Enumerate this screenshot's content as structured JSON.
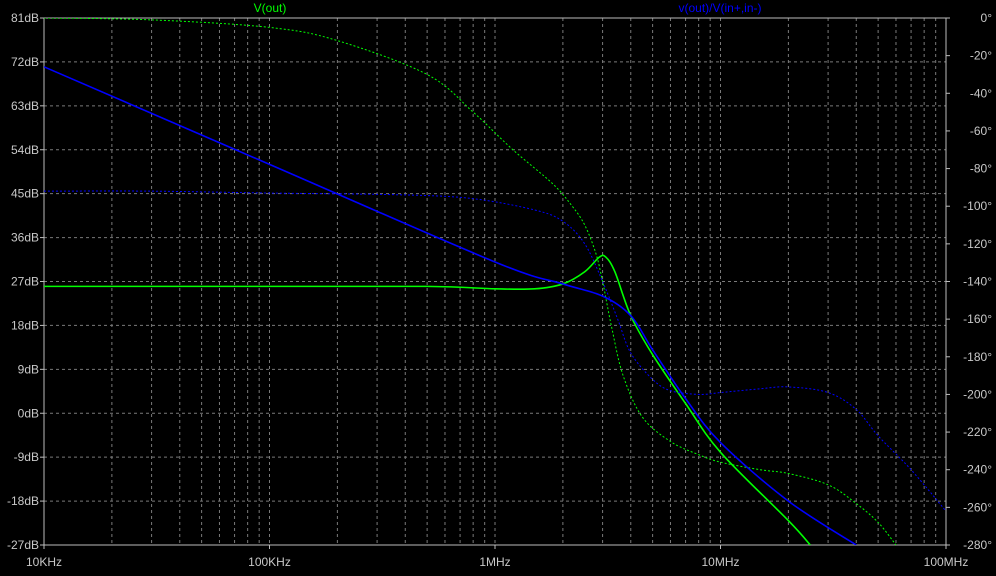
{
  "window": {
    "background": "#000000",
    "grid_color": "#7a7a7a",
    "axis_color": "#bdbdbd"
  },
  "chart_data": {
    "type": "line",
    "title": "",
    "xlabel": "",
    "ylabel": "",
    "xscale": "log",
    "xlim": [
      10000,
      100000000
    ],
    "ylim": [
      -27,
      81
    ],
    "y2lim": [
      -280,
      0
    ],
    "grid": true,
    "x_tick_labels": [
      {
        "value": 10000,
        "label": "10KHz"
      },
      {
        "value": 100000,
        "label": "100KHz"
      },
      {
        "value": 1000000,
        "label": "1MHz"
      },
      {
        "value": 10000000,
        "label": "10MHz"
      },
      {
        "value": 100000000,
        "label": "100MHz"
      }
    ],
    "y_tick_labels": [
      {
        "value": 81,
        "label": "81dB"
      },
      {
        "value": 72,
        "label": "72dB"
      },
      {
        "value": 63,
        "label": "63dB"
      },
      {
        "value": 54,
        "label": "54dB"
      },
      {
        "value": 45,
        "label": "45dB"
      },
      {
        "value": 36,
        "label": "36dB"
      },
      {
        "value": 27,
        "label": "27dB"
      },
      {
        "value": 18,
        "label": "18dB"
      },
      {
        "value": 9,
        "label": "9dB"
      },
      {
        "value": 0,
        "label": "0dB"
      },
      {
        "value": -9,
        "label": "-9dB"
      },
      {
        "value": -18,
        "label": "-18dB"
      },
      {
        "value": -27,
        "label": "-27dB"
      }
    ],
    "y2_tick_labels": [
      {
        "value": 0,
        "label": "0°"
      },
      {
        "value": -20,
        "label": "-20°"
      },
      {
        "value": -40,
        "label": "-40°"
      },
      {
        "value": -60,
        "label": "-60°"
      },
      {
        "value": -80,
        "label": "-80°"
      },
      {
        "value": -100,
        "label": "-100°"
      },
      {
        "value": -120,
        "label": "-120°"
      },
      {
        "value": -140,
        "label": "-140°"
      },
      {
        "value": -160,
        "label": "-160°"
      },
      {
        "value": -180,
        "label": "-180°"
      },
      {
        "value": -200,
        "label": "-200°"
      },
      {
        "value": -220,
        "label": "-220°"
      },
      {
        "value": -240,
        "label": "-240°"
      },
      {
        "value": -260,
        "label": "-260°"
      },
      {
        "value": -280,
        "label": "-280°"
      }
    ],
    "series": [
      {
        "name": "V(out)",
        "color": "#00ff00",
        "magnitude_db": [
          [
            10000,
            26
          ],
          [
            100000,
            26
          ],
          [
            500000,
            26
          ],
          [
            1000000,
            25.5
          ],
          [
            1500000,
            25.5
          ],
          [
            2000000,
            26.5
          ],
          [
            2500000,
            29
          ],
          [
            2900000,
            32
          ],
          [
            3100000,
            32
          ],
          [
            3400000,
            29
          ],
          [
            4000000,
            20
          ],
          [
            5000000,
            12
          ],
          [
            7000000,
            2
          ],
          [
            10000000,
            -8
          ],
          [
            20000000,
            -22
          ],
          [
            25000000,
            -27
          ]
        ],
        "phase_deg": [
          [
            10000,
            0
          ],
          [
            30000,
            -1
          ],
          [
            100000,
            -5
          ],
          [
            200000,
            -12
          ],
          [
            500000,
            -30
          ],
          [
            800000,
            -50
          ],
          [
            1200000,
            -70
          ],
          [
            1800000,
            -88
          ],
          [
            2200000,
            -100
          ],
          [
            2500000,
            -110
          ],
          [
            2800000,
            -125
          ],
          [
            3000000,
            -140
          ],
          [
            3300000,
            -165
          ],
          [
            3700000,
            -190
          ],
          [
            4500000,
            -212
          ],
          [
            6000000,
            -225
          ],
          [
            8000000,
            -232
          ],
          [
            10000000,
            -236
          ],
          [
            15000000,
            -240
          ],
          [
            20000000,
            -242
          ],
          [
            30000000,
            -248
          ],
          [
            40000000,
            -258
          ],
          [
            50000000,
            -268
          ],
          [
            60000000,
            -280
          ]
        ]
      },
      {
        "name": "v(out)/V(in+,in-)",
        "color": "#0000ff",
        "magnitude_db": [
          [
            10000,
            71
          ],
          [
            100000,
            51
          ],
          [
            1000000,
            31
          ],
          [
            2000000,
            26.5
          ],
          [
            3000000,
            24
          ],
          [
            4000000,
            20
          ],
          [
            5000000,
            13
          ],
          [
            7000000,
            3
          ],
          [
            10000000,
            -6
          ],
          [
            20000000,
            -18
          ],
          [
            40000000,
            -27
          ]
        ],
        "phase_deg": [
          [
            10000,
            -92
          ],
          [
            30000,
            -92
          ],
          [
            100000,
            -93
          ],
          [
            400000,
            -94
          ],
          [
            800000,
            -96
          ],
          [
            1500000,
            -102
          ],
          [
            2000000,
            -108
          ],
          [
            2500000,
            -120
          ],
          [
            3000000,
            -140
          ],
          [
            3500000,
            -160
          ],
          [
            4000000,
            -178
          ],
          [
            5000000,
            -192
          ],
          [
            6000000,
            -198
          ],
          [
            8000000,
            -200
          ],
          [
            10000000,
            -199
          ],
          [
            15000000,
            -197
          ],
          [
            20000000,
            -196
          ],
          [
            30000000,
            -199
          ],
          [
            40000000,
            -208
          ],
          [
            50000000,
            -222
          ],
          [
            70000000,
            -240
          ],
          [
            100000000,
            -262
          ]
        ]
      }
    ]
  }
}
